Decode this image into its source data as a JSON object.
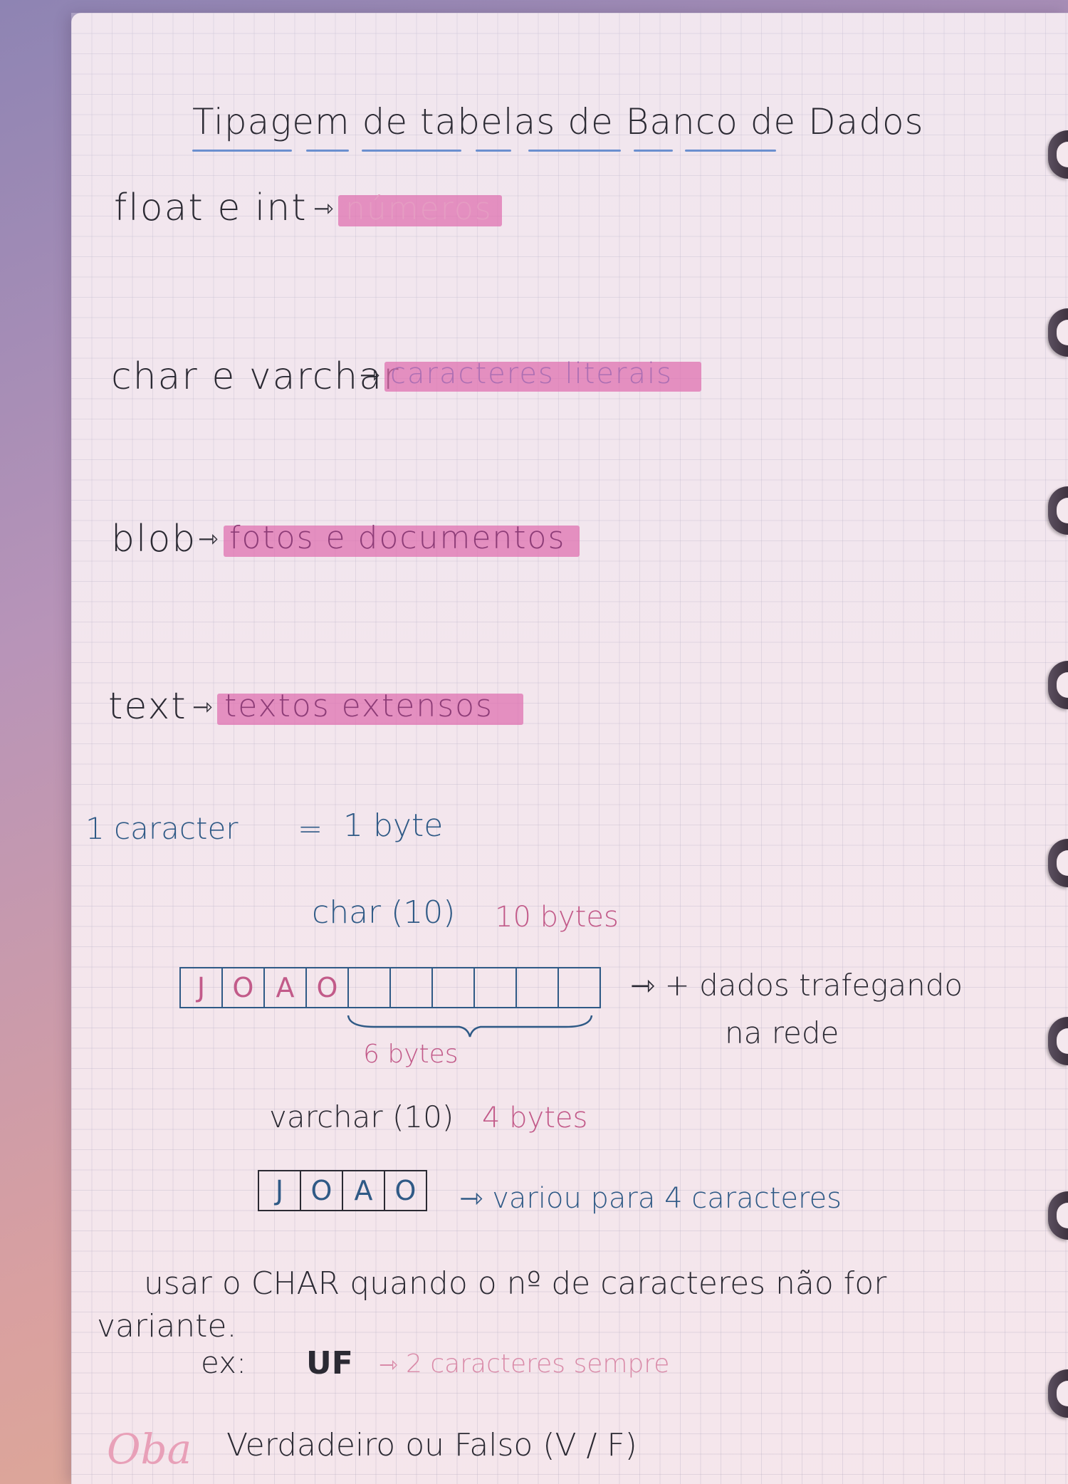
{
  "title": "Tipagem de tabelas de Banco de Dados",
  "types": [
    {
      "name": "float e int",
      "arrow": "⇾",
      "meaning": "números"
    },
    {
      "name": "char e varchar",
      "arrow": "⇾",
      "meaning": "caracteres literais"
    },
    {
      "name": "blob",
      "arrow": "⇾",
      "meaning": "fotos e documentos"
    },
    {
      "name": "text",
      "arrow": "⇾",
      "meaning": "textos extensos"
    }
  ],
  "byte_rule": {
    "left": "1 caracter",
    "eq": "=",
    "right": "1 byte"
  },
  "char_example": {
    "label": "char (10)",
    "size": "10 bytes",
    "cells": [
      "J",
      "O",
      "A",
      "O",
      "",
      "",
      "",
      "",
      "",
      ""
    ],
    "unused": "6 bytes",
    "note_line1": "⇾ + dados trafegando",
    "note_line2": "na rede"
  },
  "varchar_example": {
    "label": "varchar (10)",
    "size": "4 bytes",
    "cells": [
      "J",
      "O",
      "A",
      "O"
    ],
    "note": "⇾ variou para 4 caracteres"
  },
  "advice": {
    "line1": "usar o CHAR quando o nº de caracteres não for",
    "line2": "variante.",
    "ex_label": "ex:",
    "ex_value": "UF",
    "ex_arrow": "⇾",
    "ex_note": "2 caracteres sempre"
  },
  "footer": {
    "tag": "Oba",
    "text": "Verdadeiro ou Falso (V / F)"
  }
}
